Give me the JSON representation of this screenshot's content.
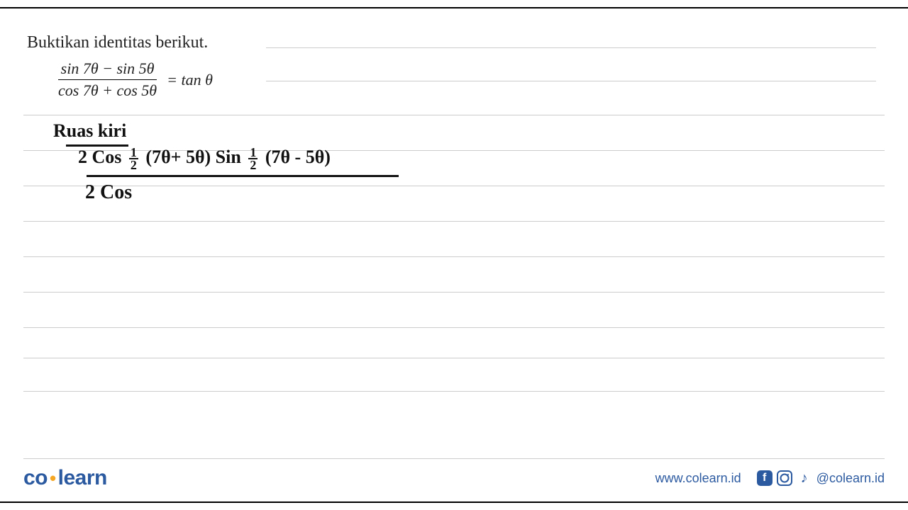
{
  "problem": {
    "title": "Buktikan identitas berikut.",
    "numerator": "sin 7θ − sin 5θ",
    "denominator": "cos 7θ + cos 5θ",
    "rhs": "= tan θ"
  },
  "handwriting": {
    "section_label": "Ruas kiri",
    "step_numerator": "2 Cos ½ (7θ + 5θ)  Sin ½ (7θ − 5θ)",
    "step_denominator": "2  Cos",
    "half_top": "1",
    "half_bottom": "2",
    "num_part1": "2 Cos",
    "num_part2": "(7θ+ 5θ)  Sin",
    "num_part3": "(7θ - 5θ)"
  },
  "footer": {
    "logo_co": "co",
    "logo_dot": "•",
    "logo_learn": "learn",
    "website": "www.colearn.id",
    "handle": "@colearn.id",
    "fb_glyph": "f",
    "tk_glyph": "♪"
  }
}
